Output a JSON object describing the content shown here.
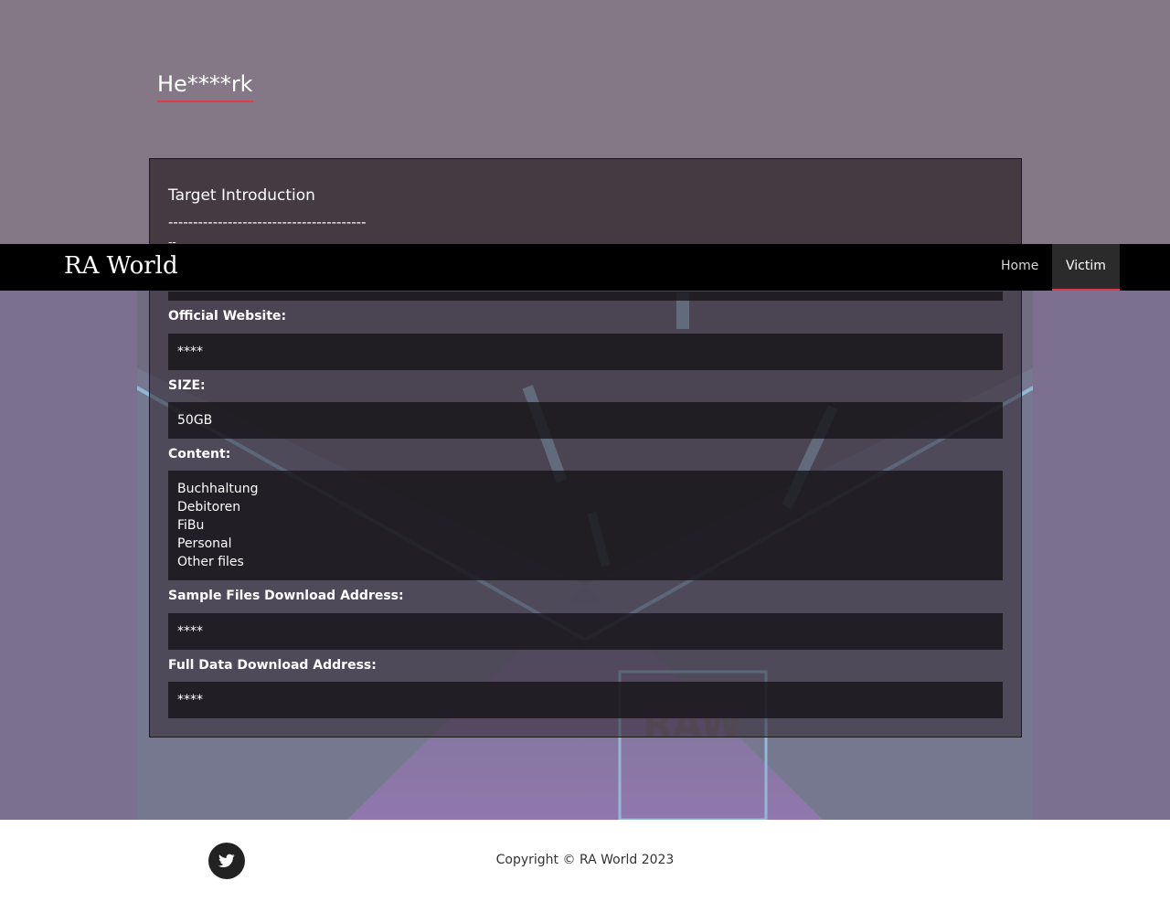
{
  "page": {
    "heading": "He****rk"
  },
  "navbar": {
    "brand": "RA World",
    "links": [
      {
        "label": "Home"
      },
      {
        "label": "Victim",
        "active": true
      }
    ]
  },
  "card": {
    "title": "Target Introduction",
    "separator": "----------------------------------------",
    "separator_tail": "--",
    "fields": [
      {
        "label": "Official Website:",
        "value": "****"
      },
      {
        "label": "SIZE:",
        "value": "50GB"
      },
      {
        "label": "Content:",
        "values": [
          "Buchhaltung",
          "Debitoren",
          "FiBu",
          "Personal",
          "Other files"
        ]
      },
      {
        "label": "Sample Files Download Address:",
        "value": "****"
      },
      {
        "label": "Full Data Download Address:",
        "value": "****"
      }
    ]
  },
  "footer": {
    "copyright": "Copyright © RA World 2023",
    "social_icon": "twitter-icon"
  },
  "background": {
    "watermark": "RAW"
  },
  "colors": {
    "accent": "#e03a48",
    "navbar": "#000000",
    "band": "#857886"
  }
}
